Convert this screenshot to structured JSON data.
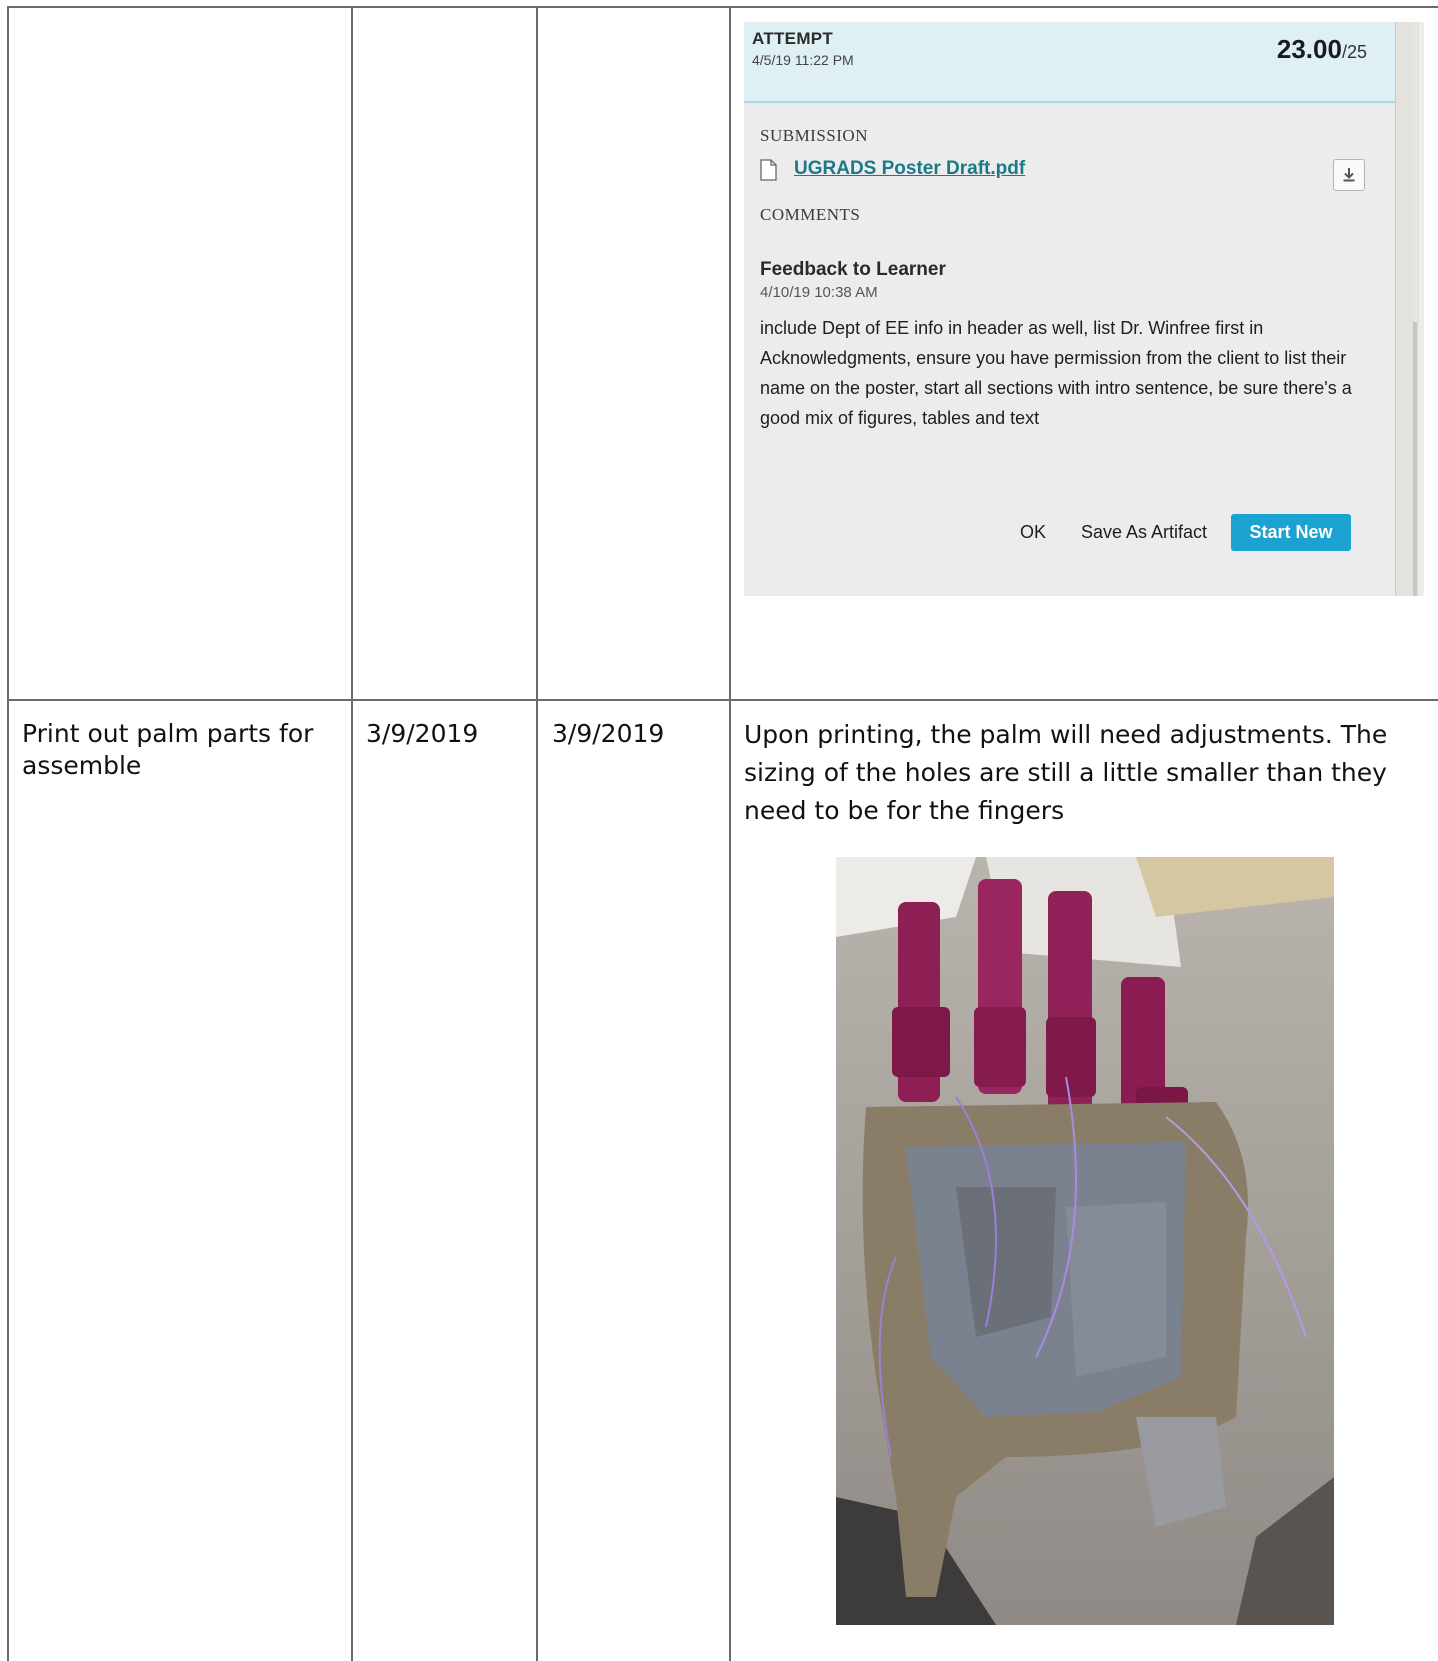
{
  "rows": [
    {
      "task": "",
      "start_date": "",
      "end_date": ""
    },
    {
      "task": "Print out palm parts for assemble",
      "start_date": "3/9/2019",
      "end_date": "3/9/2019",
      "description": "Upon printing, the palm will need adjustments. The sizing of the holes are still a little smaller than they need to be for the fingers"
    }
  ],
  "attempt": {
    "label": "ATTEMPT",
    "date": "4/5/19 11:22 PM",
    "score": "23.00",
    "out_of": "/25"
  },
  "submission": {
    "label": "SUBMISSION",
    "file_name": "UGRADS Poster Draft.pdf",
    "file_icon": "document-icon",
    "download_icon": "download-icon"
  },
  "comments": {
    "label": "COMMENTS",
    "title": "Feedback to Learner",
    "date": "4/10/19 10:38 AM",
    "text": "include Dept of EE info in header as well, list Dr. Winfree first in Acknowledgments, ensure you have permission from the client to list their name on the poster, start all sections with intro sentence, be sure there's a good mix of figures, tables and text"
  },
  "actions": {
    "ok": "OK",
    "save_artifact": "Save As Artifact",
    "start_new": "Start New"
  },
  "colors": {
    "header_bg": "#dff0f4",
    "link": "#1b7a8a",
    "primary_button": "#1aa3d1",
    "panel_bg": "#ececec",
    "grid_line": "#6b6b6b"
  }
}
